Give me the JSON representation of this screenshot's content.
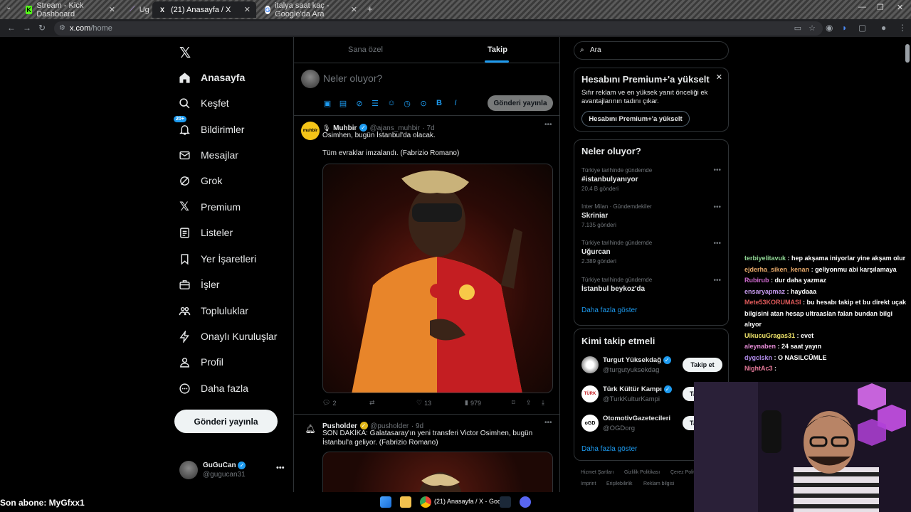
{
  "browser": {
    "tabs": [
      {
        "label": "Stream - Kick Dashboard",
        "fav": "K"
      },
      {
        "label": "Ug",
        "fav": ""
      },
      {
        "label": "(21) Anasayfa / X",
        "fav": "X"
      },
      {
        "label": "italya saat kaç - Google'da Ara",
        "fav": "G"
      }
    ],
    "url_host": "x.com",
    "url_path": "/home"
  },
  "nav": {
    "items": [
      {
        "label": "Anasayfa",
        "icon": "home-icon"
      },
      {
        "label": "Keşfet",
        "icon": "search-icon"
      },
      {
        "label": "Bildirimler",
        "icon": "bell-icon",
        "badge": "20+"
      },
      {
        "label": "Mesajlar",
        "icon": "mail-icon"
      },
      {
        "label": "Grok",
        "icon": "grok-icon"
      },
      {
        "label": "Premium",
        "icon": "x-logo-icon"
      },
      {
        "label": "Listeler",
        "icon": "list-icon"
      },
      {
        "label": "Yer İşaretleri",
        "icon": "bookmark-icon"
      },
      {
        "label": "İşler",
        "icon": "briefcase-icon"
      },
      {
        "label": "Topluluklar",
        "icon": "people-icon"
      },
      {
        "label": "Onaylı Kuruluşlar",
        "icon": "lightning-icon"
      },
      {
        "label": "Profil",
        "icon": "person-icon"
      },
      {
        "label": "Daha fazla",
        "icon": "more-circle-icon"
      }
    ],
    "post_button": "Gönderi yayınla",
    "profile": {
      "name": "GuGuCan",
      "handle": "@gugucan31"
    }
  },
  "main": {
    "tabs": [
      "Sana özel",
      "Takip"
    ],
    "compose_placeholder": "Neler oluyor?",
    "compose_button": "Gönderi yayınla",
    "tweets": [
      {
        "name": "Muhbir",
        "handle": "@ajans_muhbir",
        "time": "· 7d",
        "line1": "Osimhen, bugün İstanbul'da olacak.",
        "line2": "Tüm evraklar imzalandı. (Fabrizio Romano)",
        "replies": "2",
        "likes": "13",
        "views": "979"
      },
      {
        "name": "Pusholder",
        "handle": "@pusholder",
        "time": "· 9d",
        "line1": "SON DAKİKA: Galatasaray'ın yeni transferi Victor Osimhen, bugün",
        "line2": "İstanbul'a geliyor. (Fabrizio Romano)"
      }
    ]
  },
  "right": {
    "search_placeholder": "Ara",
    "premium": {
      "title": "Hesabını Premium+'a yükselt",
      "line1": "Sıfır reklam ve en yüksek yanıt önceliği ek",
      "line2": "avantajlarının tadını çıkar.",
      "button": "Hesabını Premium+'a yükselt"
    },
    "trends": {
      "title": "Neler oluyor?",
      "items": [
        {
          "context": "Türkiye tarihinde gündemde",
          "name": "#istanbulyanıyor",
          "count": "20,4 B gönderi"
        },
        {
          "context": "Inter Milan · Gündemdekiler",
          "name": "Skriniar",
          "count": "7.135 gönderi"
        },
        {
          "context": "Türkiye tarihinde gündemde",
          "name": "Uğurcan",
          "count": "2.389 gönderi"
        },
        {
          "context": "Türkiye tarihinde gündemde",
          "name": "İstanbul beykoz'da",
          "count": ""
        }
      ],
      "show_more": "Daha fazla göster"
    },
    "who_to_follow": {
      "title": "Kimi takip etmeli",
      "items": [
        {
          "name": "Turgut Yüksekdağ",
          "handle": "@turgutyuksekdag",
          "button": "Takip et"
        },
        {
          "name": "Türk Kültür Kampı",
          "handle": "@TurkKulturKampi",
          "button": "Ta"
        },
        {
          "name": "OtomotivGazetecileri",
          "handle": "@OGDorg",
          "button": "Ta"
        }
      ],
      "show_more": "Daha fazla göster"
    },
    "footer": [
      "Hizmet Şartları",
      "Gizlilik Politikası",
      "Çerez Polit",
      "Imprint",
      "Erişilebilirlik",
      "Reklam bilgisi"
    ]
  },
  "chat": [
    {
      "user": "terbiyelitavuk",
      "color": "#8fd694",
      "msg": "hep akşama iniyorlar yine akşam olur"
    },
    {
      "user": "ejderha_siken_kenan",
      "color": "#e7a96a",
      "msg": "geliyonmu abi karşılamaya"
    },
    {
      "user": "Rubirub",
      "color": "#d06bd0",
      "msg": "dur daha yazmaz"
    },
    {
      "user": "ensaryapmaz",
      "color": "#c89cf0",
      "msg": "haydaaa"
    },
    {
      "user": "Mete53KORUMASI",
      "color": "#e05a5a",
      "msg": "bu hesabı takip et bu direkt uçak bilgisini atan hesap ultraaslan falan bundan bilgi alıyor"
    },
    {
      "user": "UlkucuGragas31",
      "color": "#f0e46a",
      "msg": "evet"
    },
    {
      "user": "aleynaben",
      "color": "#e58cd6",
      "msg": "24 saat yayın"
    },
    {
      "user": "dygclskn",
      "color": "#b48ef0",
      "msg": "O NASILCÜMLE"
    },
    {
      "user": "NightAc3",
      "color": "#e77a9a",
      "msg": ""
    }
  ],
  "banner": "Son abone: MyGfxx1",
  "taskbar": {
    "active_label": "(21) Anasayfa / X - Goog"
  },
  "colors": {
    "accent": "#1d9bf0",
    "bg": "#000000",
    "border": "#2f3336"
  }
}
